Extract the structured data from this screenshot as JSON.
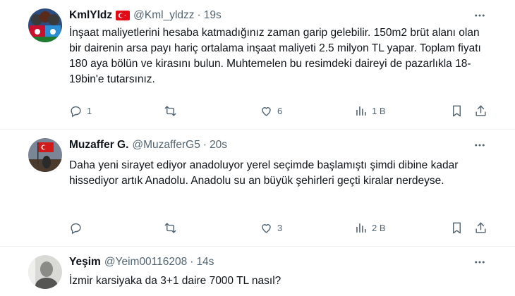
{
  "tweets": [
    {
      "name": "KmlYldz",
      "handle": "@Kml_yldzz",
      "sep": "·",
      "time": "19s",
      "text": "İnşaat maliyetlerini hesaba katmadığınız zaman garip gelebilir. 150m2 brüt alanı olan bir dairenin arsa payı hariç ortalama inşaat maliyeti 2.5 milyon TL yapar. Toplam fiyatı 180 aya bölün ve kirasını bulun. Muhtemelen bu resimdeki daireyi de pazarlıkla 18-19bin'e tutarsınız.",
      "replies": "1",
      "retweets": "",
      "likes": "6",
      "views": "1 B"
    },
    {
      "name": "Muzaffer G.",
      "handle": "@MuzafferG5",
      "sep": "·",
      "time": "20s",
      "text": "Daha yeni sirayet ediyor anadoluyor yerel seçimde başlamıştı şimdi dibine kadar hissediyor artık Anadolu. Anadolu su an büyük şehirleri geçti kiralar nerdeyse.",
      "replies": "",
      "retweets": "",
      "likes": "3",
      "views": "2 B"
    },
    {
      "name": "Yeşim",
      "handle": "@Yeim00116208",
      "sep": "·",
      "time": "14s",
      "text": "İzmir karsiyaka da 3+1  daire 7000 TL nasıl?"
    }
  ],
  "icons": {
    "reply": "reply-icon",
    "retweet": "retweet-icon",
    "like": "like-icon",
    "views": "views-icon",
    "bookmark": "bookmark-icon",
    "share": "share-icon",
    "more": "more-icon",
    "flag": "turkey-flag-icon"
  },
  "colors": {
    "text": "#0f1419",
    "secondary": "#536471",
    "divider": "#eff3f4",
    "flag_red": "#e30a17"
  }
}
